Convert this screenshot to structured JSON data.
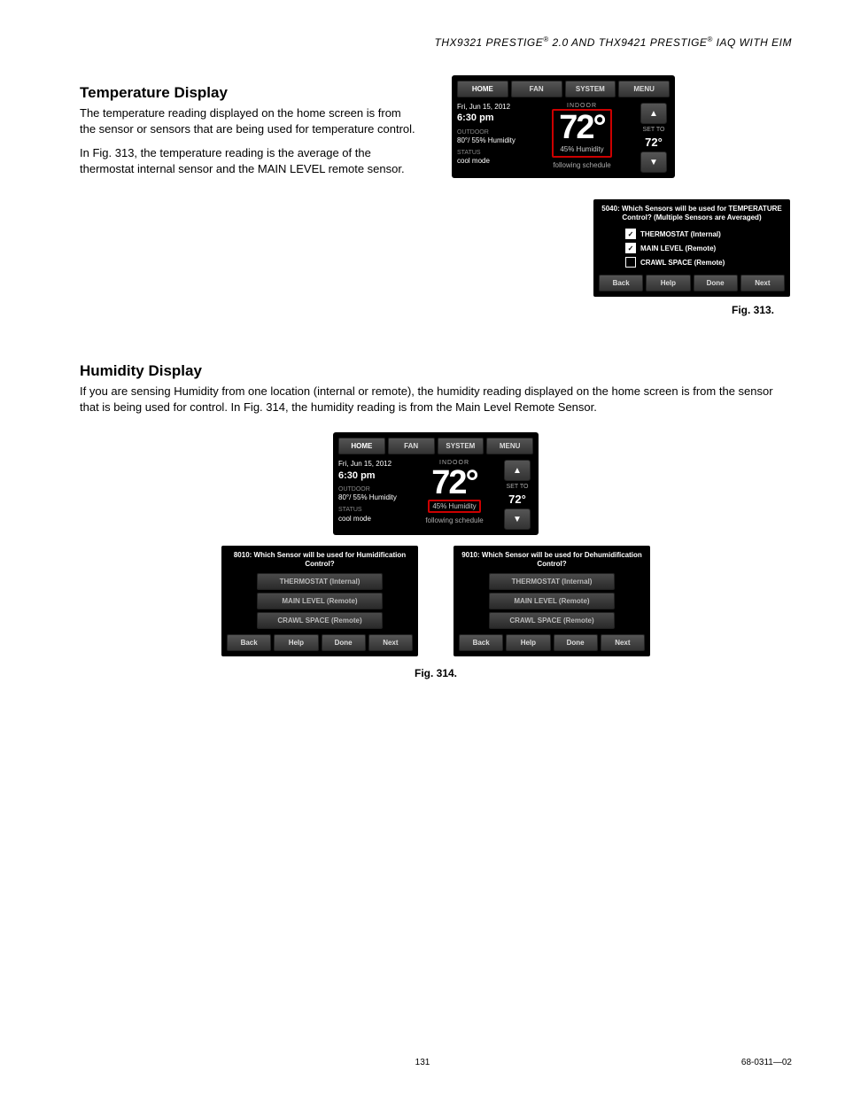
{
  "header": {
    "line": "THX9321 PRESTIGE® 2.0 AND THX9421 PRESTIGE® IAQ WITH EIM"
  },
  "section1": {
    "title": "Temperature Display",
    "p1": "The temperature reading displayed on the home screen is from the sensor or sensors that are being used for temperature control.",
    "p2": "In Fig. 313, the temperature reading is the average of the thermostat internal sensor and the MAIN LEVEL remote sensor."
  },
  "section2": {
    "title": "Humidity Display",
    "p1": "If you are sensing Humidity from one location (internal or remote), the humidity reading displayed on the home screen is from the sensor that is being used for control. In Fig. 314, the humidity reading is from the Main Level Remote Sensor."
  },
  "thermo": {
    "tabs": [
      "HOME",
      "FAN",
      "SYSTEM",
      "MENU"
    ],
    "date": "Fri, Jun 15, 2012",
    "time": "6:30 pm",
    "outdoor_lbl": "OUTDOOR",
    "outdoor_val": "80°/ 55% Humidity",
    "status_lbl": "STATUS",
    "status_val": "cool mode",
    "indoor_lbl": "INDOOR",
    "big_temp": "72°",
    "humidity": "45% Humidity",
    "schedule": "following schedule",
    "setto_lbl": "SET TO",
    "setto_val": "72°"
  },
  "sensor313": {
    "question": "5040: Which Sensors will be used for TEMPERATURE Control? (Multiple Sensors are Averaged)",
    "opts": [
      {
        "label": "THERMOSTAT (Internal)",
        "checked": true
      },
      {
        "label": "MAIN LEVEL (Remote)",
        "checked": true
      },
      {
        "label": "CRAWL SPACE (Remote)",
        "checked": false
      }
    ],
    "btns": [
      "Back",
      "Help",
      "Done",
      "Next"
    ]
  },
  "fig313": "Fig. 313.",
  "fig314": "Fig. 314.",
  "panelA": {
    "question": "8010: Which Sensor will be used for Humidification Control?",
    "opts": [
      "THERMOSTAT (Internal)",
      "MAIN LEVEL (Remote)",
      "CRAWL SPACE (Remote)"
    ],
    "btns": [
      "Back",
      "Help",
      "Done",
      "Next"
    ]
  },
  "panelB": {
    "question": "9010: Which Sensor will be used for Dehumidification Control?",
    "opts": [
      "THERMOSTAT (Internal)",
      "MAIN LEVEL (Remote)",
      "CRAWL SPACE (Remote)"
    ],
    "btns": [
      "Back",
      "Help",
      "Done",
      "Next"
    ]
  },
  "footer": {
    "page": "131",
    "doc": "68-0311—02"
  }
}
